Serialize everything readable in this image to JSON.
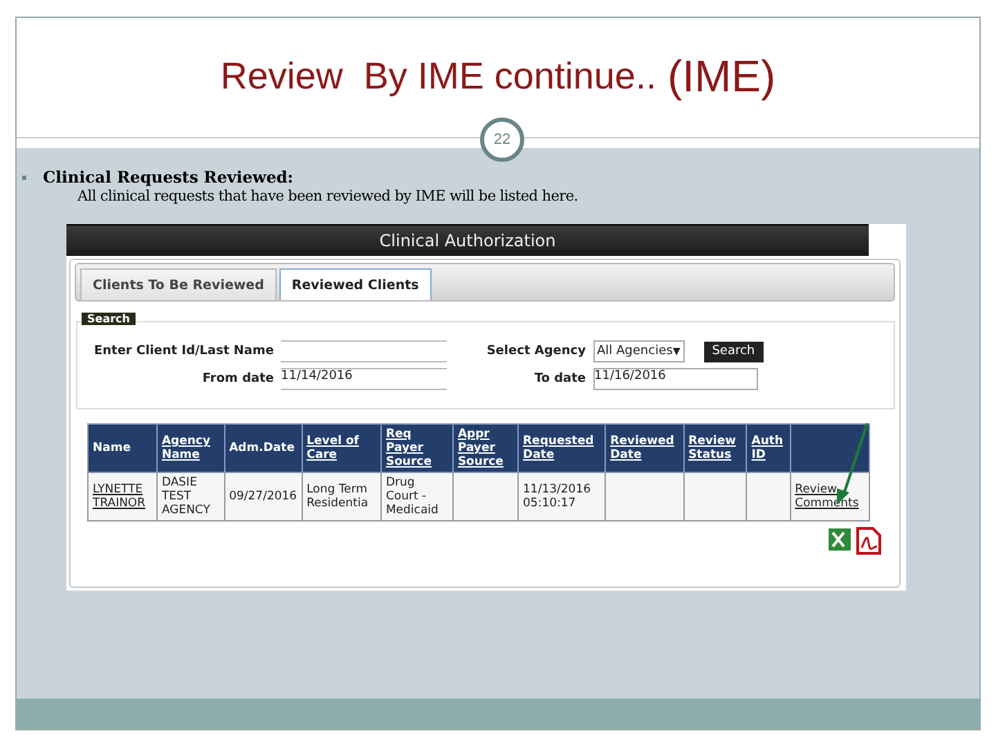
{
  "slide": {
    "title": "Review  By IME continue..",
    "title_suffix": "(IME)",
    "page_number": "22"
  },
  "bullet": {
    "heading": "Clinical Requests Reviewed:",
    "text": "All clinical requests that have been reviewed by IME will be listed here."
  },
  "app": {
    "header": "Clinical Authorization",
    "tabs": [
      {
        "label": "Clients To Be Reviewed",
        "selected": false
      },
      {
        "label": "Reviewed Clients",
        "selected": true
      }
    ],
    "search": {
      "legend": "Search",
      "client_label": "Enter Client Id/Last Name",
      "from_label": "From date",
      "from_value": "11/14/2016",
      "agency_label": "Select Agency",
      "agency_value": "All Agencies",
      "agency_arrow": "▼",
      "to_label": "To date",
      "to_value": "11/16/2016",
      "button": "Search"
    },
    "table": {
      "columns": [
        {
          "label": "Name",
          "link": false
        },
        {
          "label": "Agency Name",
          "link": true
        },
        {
          "label": "Adm.Date",
          "link": false
        },
        {
          "label": "Level of Care",
          "link": true
        },
        {
          "label": "Req Payer Source",
          "link": true
        },
        {
          "label": "Appr Payer Source",
          "link": true
        },
        {
          "label": "Requested Date",
          "link": true
        },
        {
          "label": "Reviewed Date",
          "link": true
        },
        {
          "label": "Review Status",
          "link": true
        },
        {
          "label": "Auth ID",
          "link": true
        },
        null
      ],
      "rows": [
        {
          "cells": [
            {
              "text": "LYNETTE TRAINOR",
              "link": true
            },
            {
              "text": "DASIE TEST AGENCY",
              "link": false
            },
            {
              "text": "09/27/2016",
              "link": false
            },
            {
              "text": "Long Term Residentia",
              "link": false
            },
            {
              "text": "Drug Court - Medicaid",
              "link": false
            },
            null,
            {
              "text": "11/13/2016 05:10:17",
              "link": false
            },
            null,
            null,
            null,
            {
              "text": "Review Comments",
              "link": true
            }
          ]
        }
      ]
    }
  }
}
